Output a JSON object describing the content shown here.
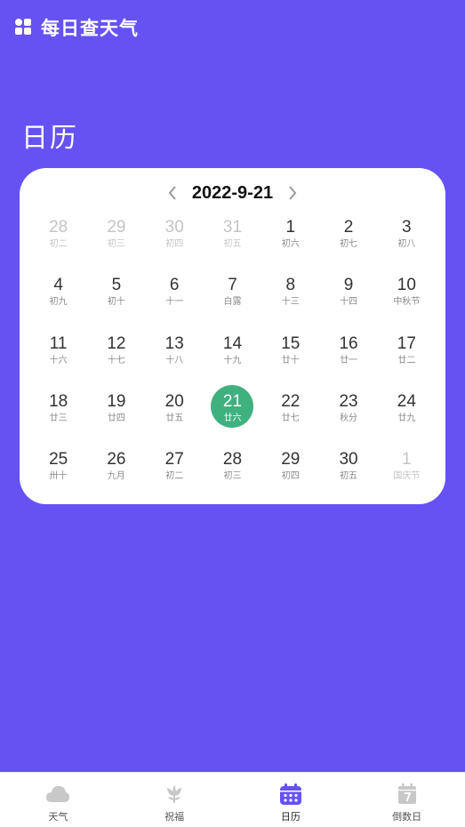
{
  "app": {
    "title": "每日查天气"
  },
  "page": {
    "title": "日历"
  },
  "calendar": {
    "month_label": "2022-9-21",
    "selected_day": "21",
    "days": [
      {
        "num": "28",
        "lunar": "初二",
        "other": true
      },
      {
        "num": "29",
        "lunar": "初三",
        "other": true
      },
      {
        "num": "30",
        "lunar": "初四",
        "other": true
      },
      {
        "num": "31",
        "lunar": "初五",
        "other": true
      },
      {
        "num": "1",
        "lunar": "初六"
      },
      {
        "num": "2",
        "lunar": "初七"
      },
      {
        "num": "3",
        "lunar": "初八"
      },
      {
        "num": "4",
        "lunar": "初九"
      },
      {
        "num": "5",
        "lunar": "初十"
      },
      {
        "num": "6",
        "lunar": "十一"
      },
      {
        "num": "7",
        "lunar": "白露"
      },
      {
        "num": "8",
        "lunar": "十三"
      },
      {
        "num": "9",
        "lunar": "十四"
      },
      {
        "num": "10",
        "lunar": "中秋节"
      },
      {
        "num": "11",
        "lunar": "十六"
      },
      {
        "num": "12",
        "lunar": "十七"
      },
      {
        "num": "13",
        "lunar": "十八"
      },
      {
        "num": "14",
        "lunar": "十九"
      },
      {
        "num": "15",
        "lunar": "廿十"
      },
      {
        "num": "16",
        "lunar": "廿一"
      },
      {
        "num": "17",
        "lunar": "廿二"
      },
      {
        "num": "18",
        "lunar": "廿三"
      },
      {
        "num": "19",
        "lunar": "廿四"
      },
      {
        "num": "20",
        "lunar": "廿五"
      },
      {
        "num": "21",
        "lunar": "廿六",
        "selected": true
      },
      {
        "num": "22",
        "lunar": "廿七"
      },
      {
        "num": "23",
        "lunar": "秋分"
      },
      {
        "num": "24",
        "lunar": "廿九"
      },
      {
        "num": "25",
        "lunar": "卅十"
      },
      {
        "num": "26",
        "lunar": "九月"
      },
      {
        "num": "27",
        "lunar": "初二"
      },
      {
        "num": "28",
        "lunar": "初三"
      },
      {
        "num": "29",
        "lunar": "初四"
      },
      {
        "num": "30",
        "lunar": "初五"
      },
      {
        "num": "1",
        "lunar": "国庆节",
        "other": true
      }
    ]
  },
  "tabs": [
    {
      "label": "天气",
      "icon": "cloud-icon",
      "active": false
    },
    {
      "label": "祝福",
      "icon": "flower-icon",
      "active": false
    },
    {
      "label": "日历",
      "icon": "calendar-icon",
      "active": true
    },
    {
      "label": "倒数日",
      "icon": "countdown-calendar-icon",
      "active": false
    }
  ],
  "colors": {
    "background": "#6652f3",
    "selected_day": "#3fb17f",
    "active_tab": "#6652f3",
    "inactive_tab_icon": "#c8c8c8"
  }
}
